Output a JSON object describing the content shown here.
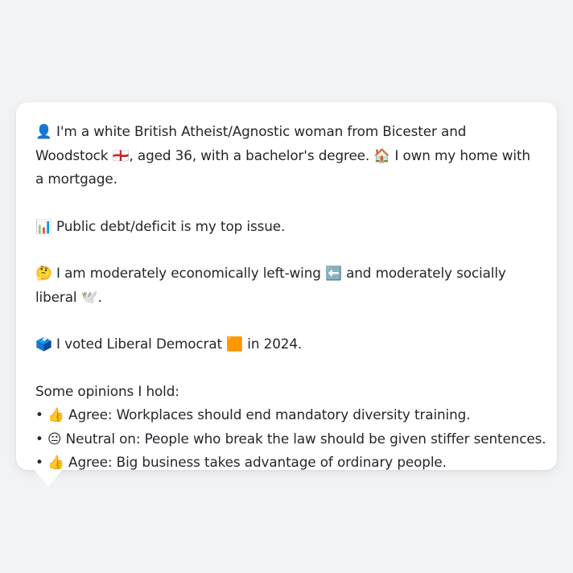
{
  "persona": {
    "intro": "👤 I'm a white British Atheist/Agnostic woman from Bicester and Woodstock 🏴󠁧󠁢󠁥󠁮󠁧󠁿, aged 36, with a bachelor's degree. 🏠 I own my home with a mortgage.",
    "top_issue": "📊 Public debt/deficit is my top issue.",
    "ideology": "🤔 I am moderately economically left-wing ⬅️ and moderately socially liberal 🕊️.",
    "vote": "🗳️ I voted Liberal Democrat 🟧 in 2024.",
    "opinions_heading": "Some opinions I hold:",
    "opinions": [
      "• 👍 Agree: Workplaces should end mandatory diversity training.",
      "• 😐 Neutral on: People who break the law should be given stiffer sentences.",
      "• 👍 Agree: Big business takes advantage of ordinary people."
    ]
  }
}
